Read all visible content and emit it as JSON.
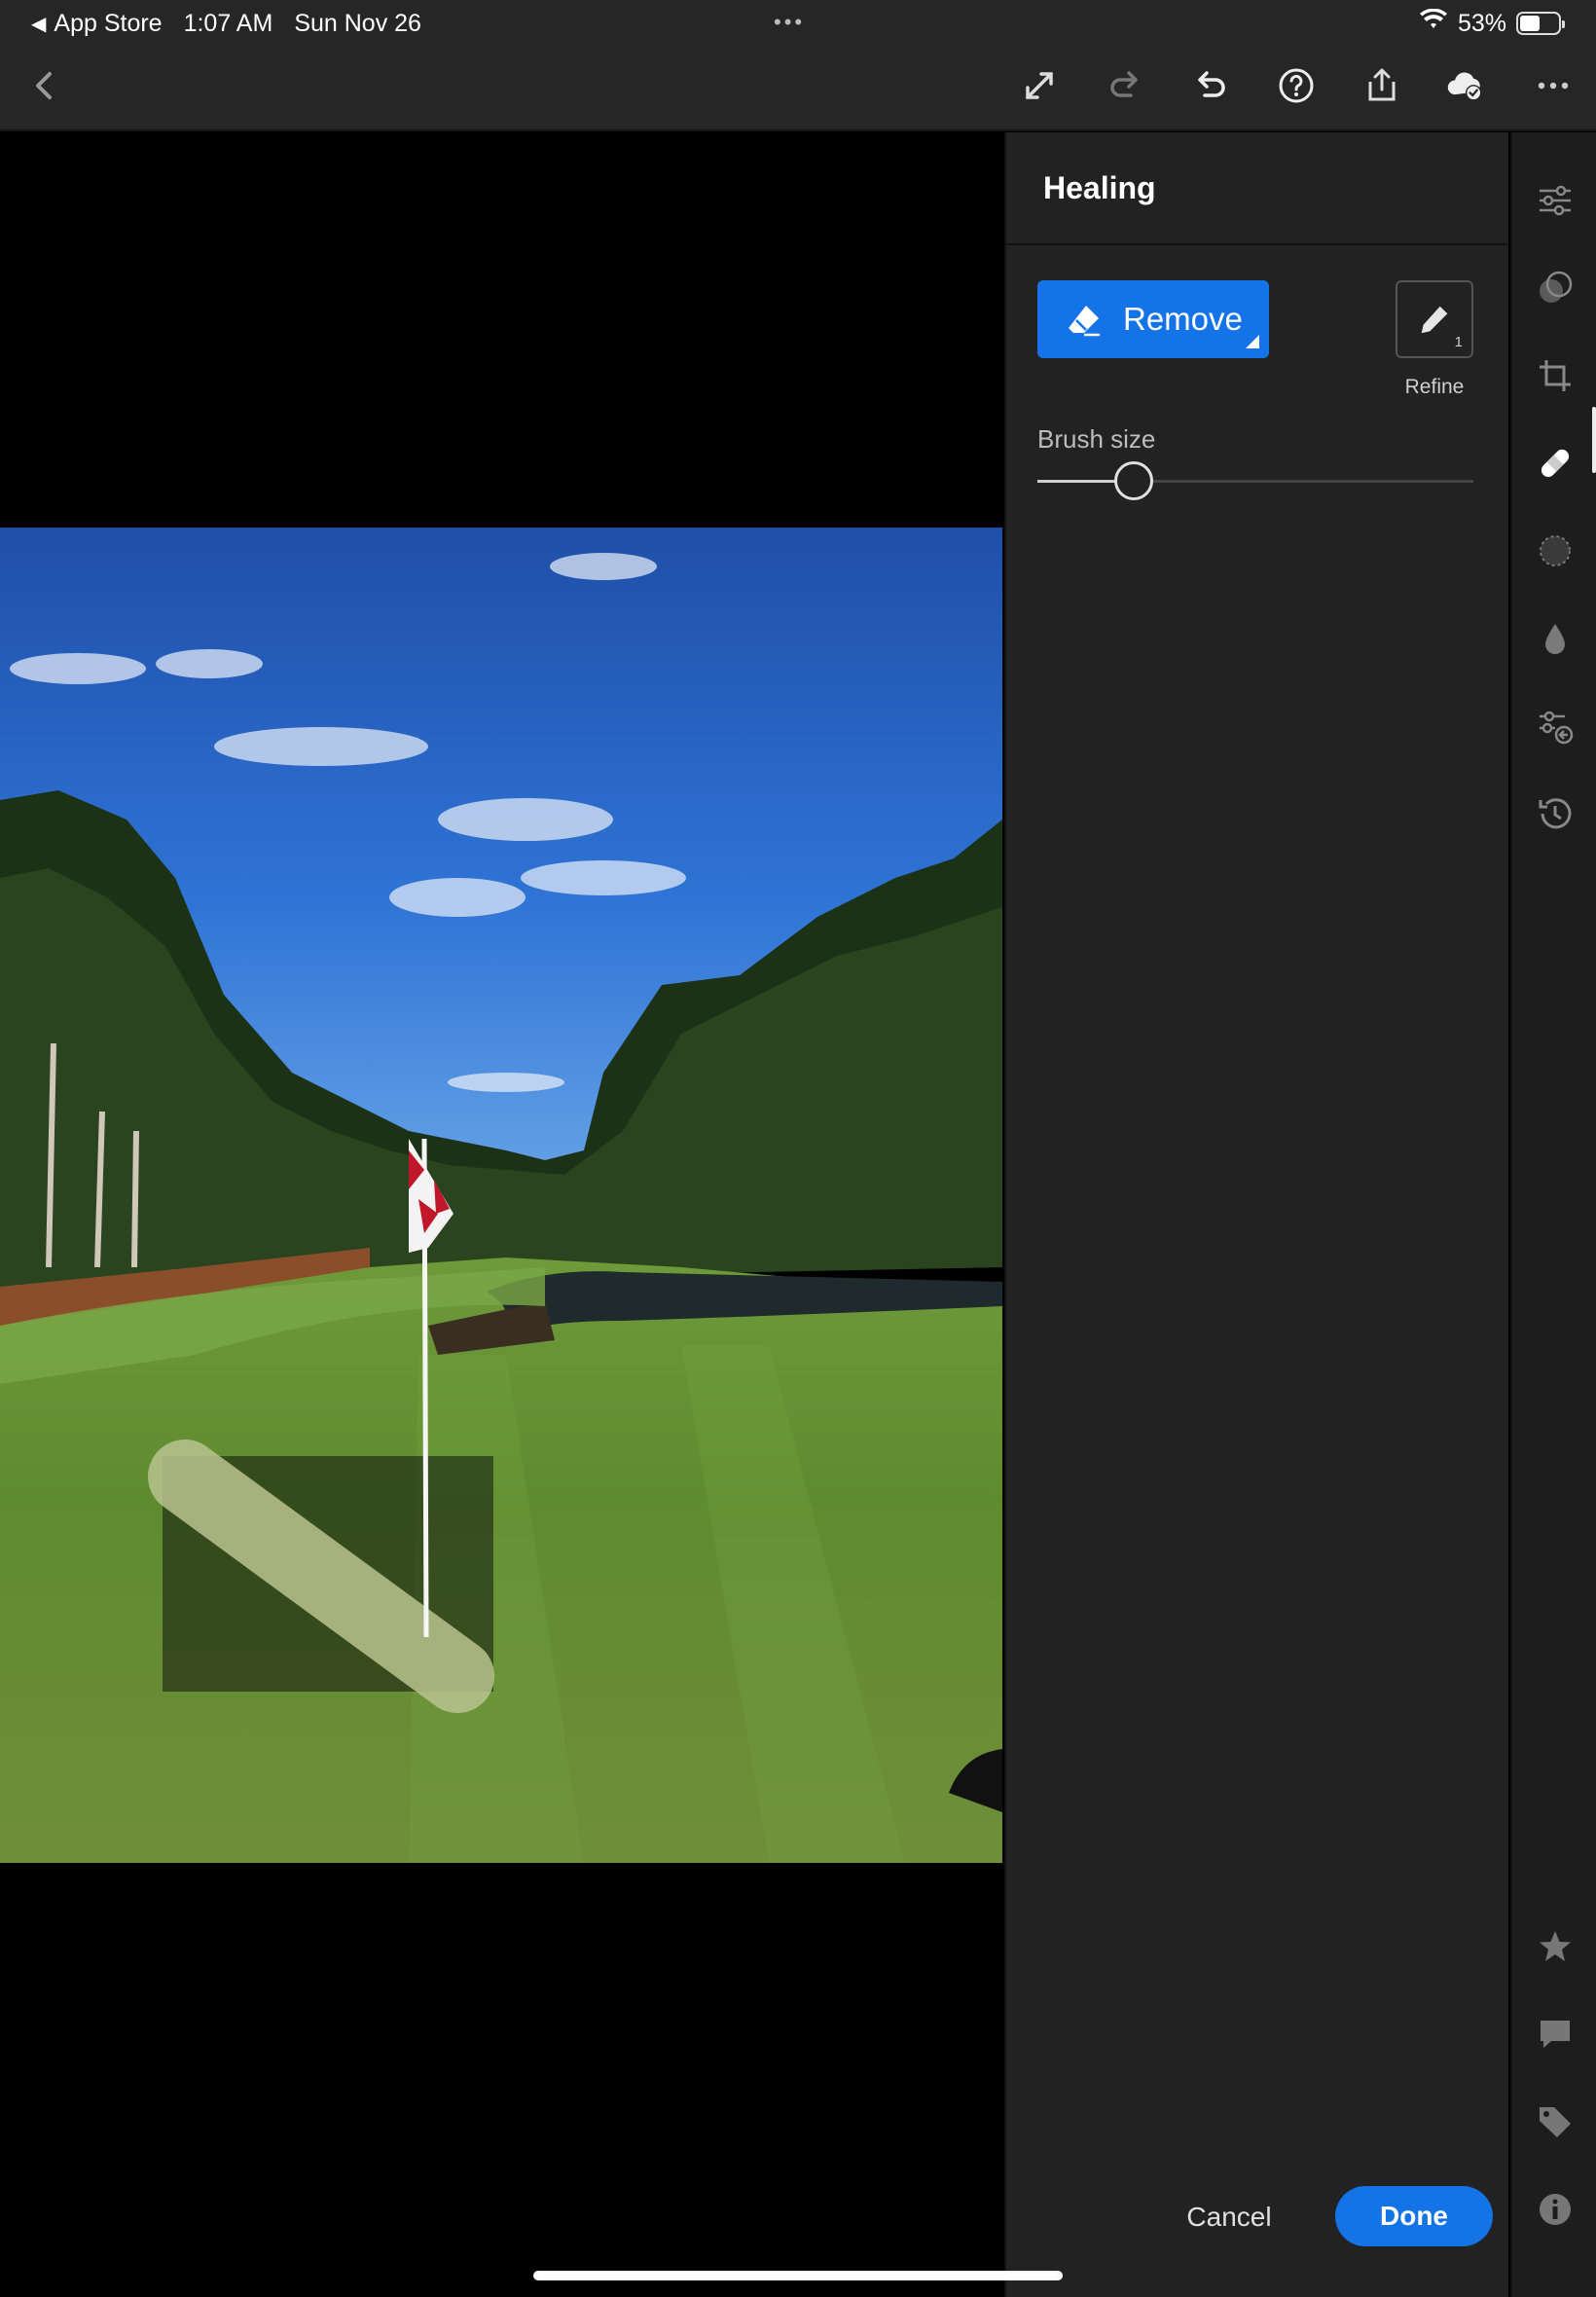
{
  "status_bar": {
    "back_app": "App Store",
    "time": "1:07 AM",
    "date": "Sun Nov 26",
    "multitask_dots": "•••",
    "battery": "53%",
    "battery_level": 0.53
  },
  "toolbar": {
    "icons": [
      "back-icon",
      "expand-icon",
      "redo-icon",
      "undo-icon",
      "help-icon",
      "share-icon",
      "cloud-synced-icon",
      "more-icon"
    ]
  },
  "panel": {
    "title": "Healing",
    "remove_label": "Remove",
    "refine_label": "Refine",
    "refine_count": "1",
    "brush_size_label": "Brush size",
    "brush_size_value": 0.22,
    "cancel_label": "Cancel",
    "done_label": "Done",
    "accent_color": "#1473e6"
  },
  "rail": {
    "items": [
      "edit-sliders-icon",
      "presets-icon",
      "crop-icon",
      "healing-icon",
      "masking-icon",
      "blur-icon",
      "versions-icon",
      "history-icon",
      "rating-icon",
      "comments-icon",
      "keywords-icon",
      "info-icon"
    ],
    "active": "healing-icon"
  }
}
